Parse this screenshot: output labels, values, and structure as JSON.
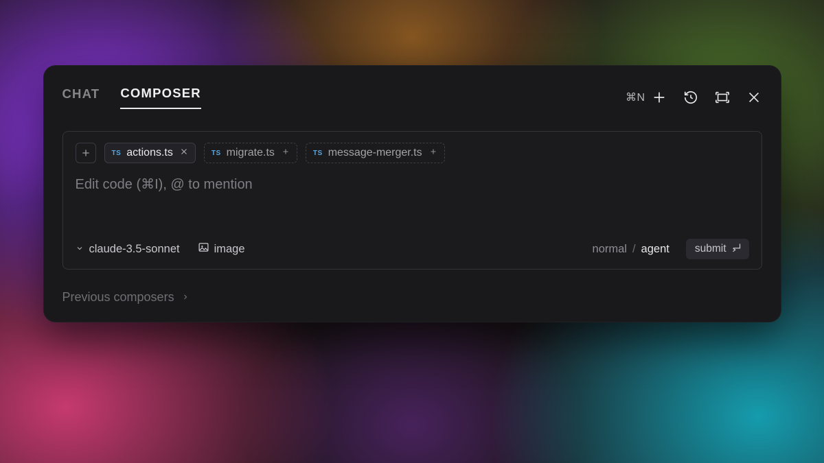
{
  "tabs": {
    "chat": "CHAT",
    "composer": "COMPOSER",
    "active": "composer"
  },
  "topbar": {
    "new_shortcut": "⌘N"
  },
  "context_chips": [
    {
      "badge": "TS",
      "name": "actions.ts",
      "trailing": "close",
      "style": "solid"
    },
    {
      "badge": "TS",
      "name": "migrate.ts",
      "trailing": "plus",
      "style": "dashed"
    },
    {
      "badge": "TS",
      "name": "message-merger.ts",
      "trailing": "plus",
      "style": "dashed"
    }
  ],
  "prompt": {
    "placeholder": "Edit code (⌘I), @ to mention",
    "value": ""
  },
  "footer": {
    "model": "claude-3.5-sonnet",
    "image_label": "image",
    "mode_normal": "normal",
    "mode_sep": "/",
    "mode_agent": "agent",
    "submit_label": "submit"
  },
  "previous_label": "Previous composers"
}
